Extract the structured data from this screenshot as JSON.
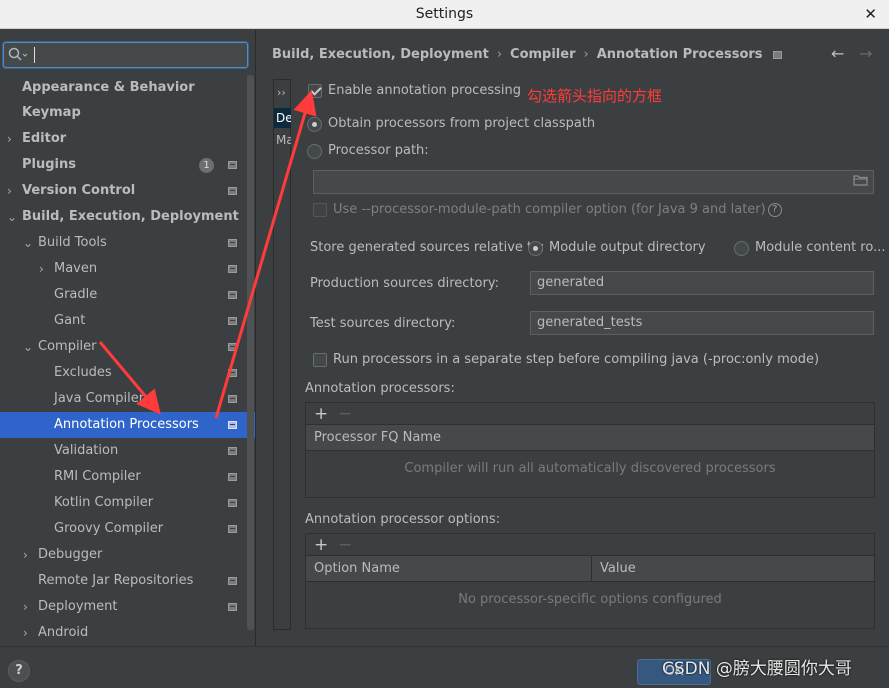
{
  "window": {
    "title": "Settings",
    "close_glyph": "✕"
  },
  "search": {
    "value": "",
    "placeholder": ""
  },
  "sidebar": {
    "items": [
      {
        "label": "Appearance & Behavior"
      },
      {
        "label": "Keymap"
      },
      {
        "label": "Editor"
      },
      {
        "label": "Plugins",
        "badge": "1"
      },
      {
        "label": "Version Control"
      },
      {
        "label": "Build, Execution, Deployment"
      },
      {
        "label": "Build Tools"
      },
      {
        "label": "Maven"
      },
      {
        "label": "Gradle"
      },
      {
        "label": "Gant"
      },
      {
        "label": "Compiler"
      },
      {
        "label": "Excludes"
      },
      {
        "label": "Java Compiler"
      },
      {
        "label": "Annotation Processors"
      },
      {
        "label": "Validation"
      },
      {
        "label": "RMI Compiler"
      },
      {
        "label": "Kotlin Compiler"
      },
      {
        "label": "Groovy Compiler"
      },
      {
        "label": "Debugger"
      },
      {
        "label": "Remote Jar Repositories"
      },
      {
        "label": "Deployment"
      },
      {
        "label": "Android"
      }
    ]
  },
  "breadcrumb": {
    "items": [
      "Build, Execution, Deployment",
      "Compiler",
      "Annotation Processors"
    ],
    "separator": "›",
    "back_glyph": "←",
    "forward_glyph": "→"
  },
  "profiles": {
    "expand_glyph": "››",
    "items": [
      "De",
      "Ma"
    ]
  },
  "settings": {
    "enable_label": "Enable annotation processing",
    "obtain_label": "Obtain processors from project classpath",
    "path_label": "Processor path:",
    "path_value": "",
    "module_path_label": "Use --processor-module-path compiler option (for Java 9 and later)",
    "help_glyph": "?",
    "store_label": "Store generated sources relative to:",
    "module_output_label": "Module output directory",
    "module_content_label": "Module content ro...",
    "production_label": "Production sources directory:",
    "production_value": "generated",
    "test_label": "Test sources directory:",
    "test_value": "generated_tests",
    "separate_step_label": "Run processors in a separate step before compiling java (-proc:only mode)"
  },
  "annotation": {
    "text": "勾选箭头指向的方框",
    "color": "#ff3b3b"
  },
  "processors_table": {
    "label": "Annotation processors:",
    "add_glyph": "+",
    "remove_glyph": "−",
    "columns": [
      "Processor FQ Name"
    ],
    "empty_text": "Compiler will run all automatically discovered processors"
  },
  "options_table": {
    "label": "Annotation processor options:",
    "add_glyph": "+",
    "remove_glyph": "−",
    "columns": [
      "Option Name",
      "Value"
    ],
    "empty_text": "No processor-specific options configured"
  },
  "footer": {
    "help_glyph": "?",
    "ok_label": "OK",
    "watermark": "CSDN @膀大腰圆你大哥"
  },
  "colors": {
    "selection": "#2f65ca",
    "background": "#3c3f41",
    "accent_red": "#ff3b3b"
  }
}
